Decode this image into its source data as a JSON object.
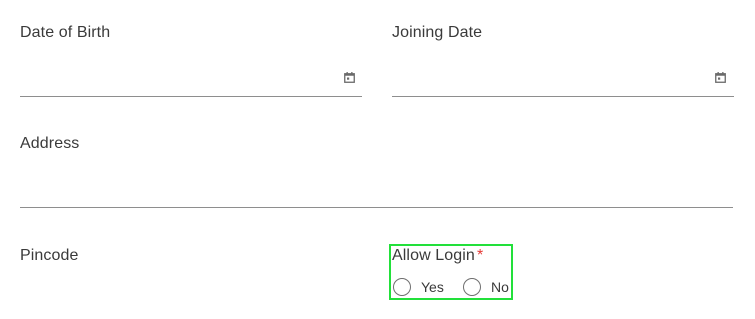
{
  "form": {
    "date_of_birth": {
      "label": "Date of Birth",
      "value": "",
      "icon": "calendar-icon"
    },
    "joining_date": {
      "label": "Joining Date",
      "value": "",
      "icon": "calendar-icon"
    },
    "address": {
      "label": "Address",
      "value": ""
    },
    "pincode": {
      "label": "Pincode",
      "value": ""
    },
    "allow_login": {
      "label": "Allow Login",
      "required_mark": "*",
      "options": [
        {
          "label": "Yes",
          "selected": false
        },
        {
          "label": "No",
          "selected": false
        }
      ],
      "highlight_color": "#22e03a"
    }
  },
  "colors": {
    "label_text": "#3a3a3a",
    "underline": "#8e8e8e",
    "required": "#e53935"
  }
}
